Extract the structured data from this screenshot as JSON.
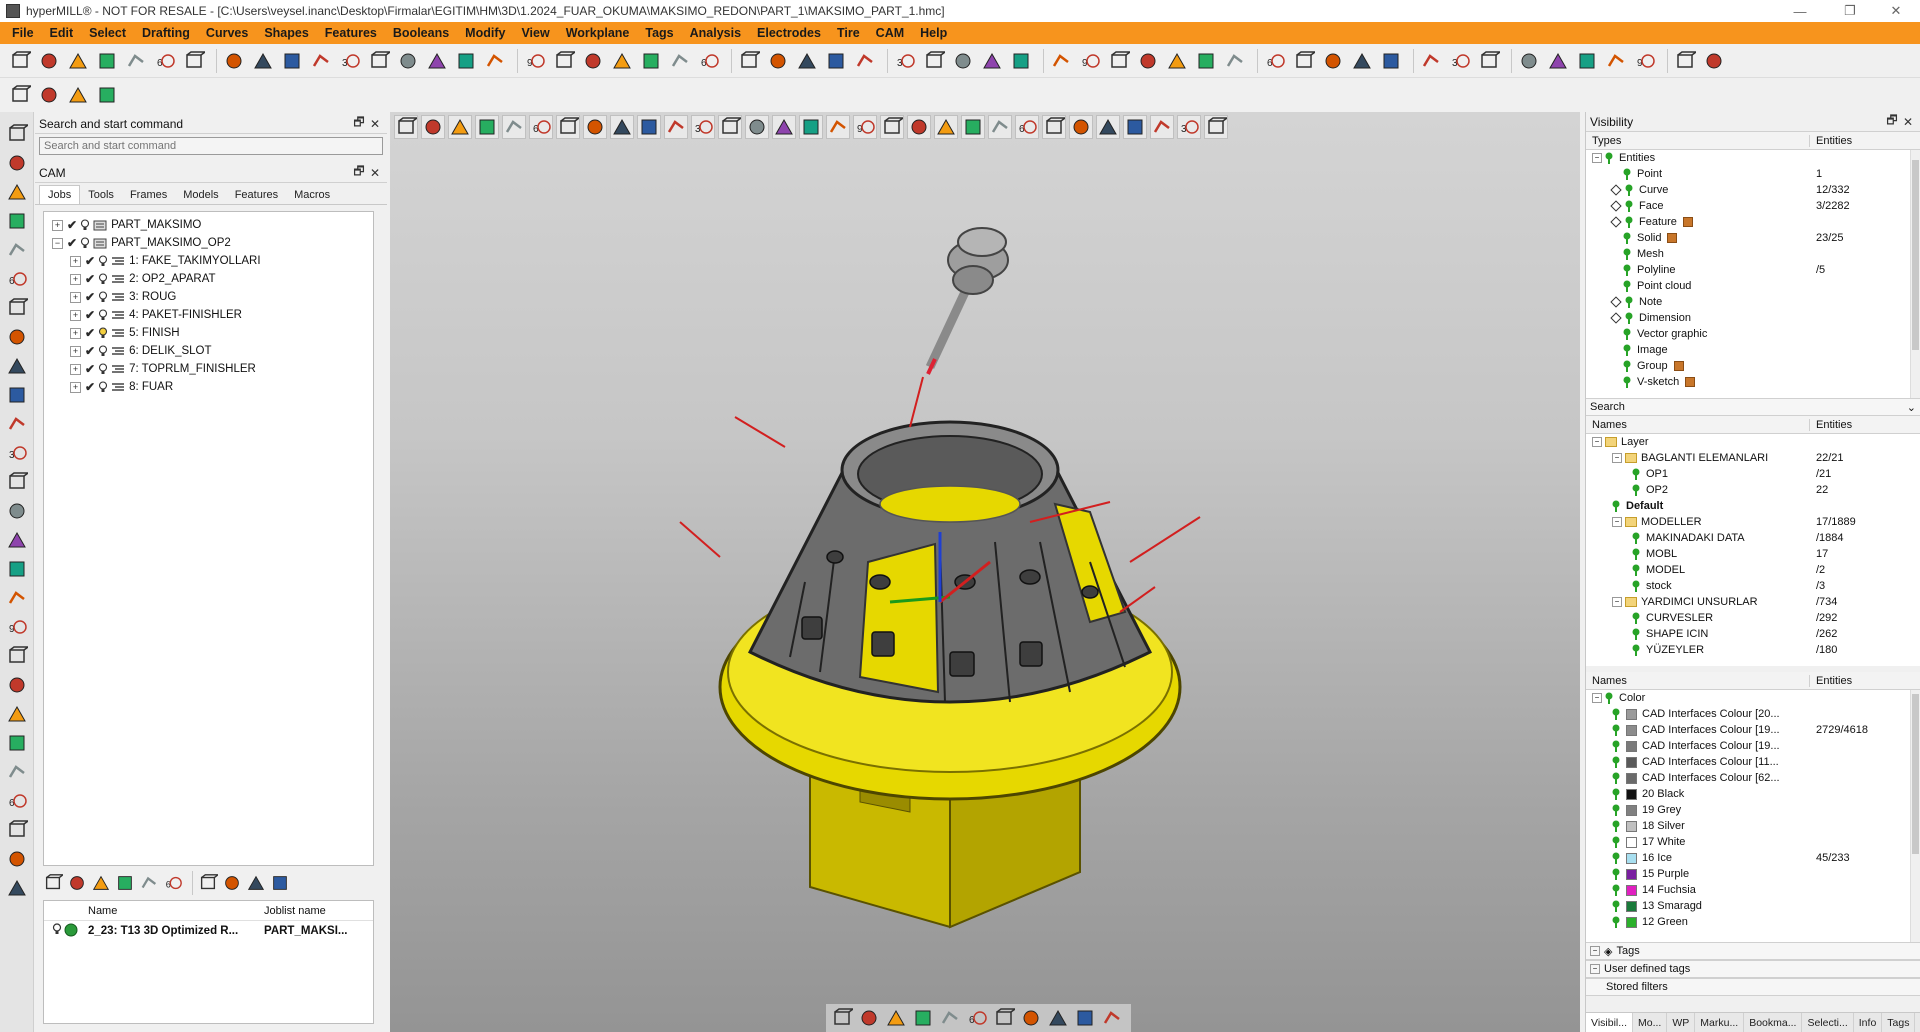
{
  "window": {
    "title": "hyperMILL® - NOT FOR RESALE - [C:\\Users\\veysel.inanc\\Desktop\\Firmalar\\EGITIM\\HM\\3D\\1.2024_FUAR_OKUMA\\MAKSIMO_REDON\\PART_1\\MAKSIMO_PART_1.hmc]",
    "minimize": "—",
    "maximize": "❐",
    "close": "✕"
  },
  "menu": [
    "File",
    "Edit",
    "Select",
    "Drafting",
    "Curves",
    "Shapes",
    "Features",
    "Booleans",
    "Modify",
    "View",
    "Workplane",
    "Tags",
    "Analysis",
    "Electrodes",
    "Tire",
    "CAM",
    "Help"
  ],
  "search_panel": {
    "title": "Search and start command",
    "placeholder": "Search and start command",
    "float_icon": "🗗",
    "close_icon": "✕"
  },
  "cam_panel": {
    "title": "CAM",
    "tabs": [
      "Jobs",
      "Tools",
      "Frames",
      "Models",
      "Features",
      "Macros"
    ],
    "active_tab": "Jobs",
    "tree": [
      {
        "label": "PART_MAKSIMO",
        "level": 0,
        "expander": "+"
      },
      {
        "label": "PART_MAKSIMO_OP2",
        "level": 0,
        "expander": "−"
      },
      {
        "label": "1: FAKE_TAKIMYOLLARI",
        "level": 1,
        "expander": "+"
      },
      {
        "label": "2: OP2_APARAT",
        "level": 1,
        "expander": "+"
      },
      {
        "label": "3: ROUG",
        "level": 1,
        "expander": "+"
      },
      {
        "label": "4: PAKET-FINISHLER",
        "level": 1,
        "expander": "+"
      },
      {
        "label": "5: FINISH",
        "level": 1,
        "expander": "+"
      },
      {
        "label": "6: DELIK_SLOT",
        "level": 1,
        "expander": "+"
      },
      {
        "label": "7: TOPRLM_FINISHLER",
        "level": 1,
        "expander": "+"
      },
      {
        "label": "8: FUAR",
        "level": 1,
        "expander": "+"
      }
    ],
    "check_glyph": "✔",
    "joblist": {
      "col_name": "Name",
      "col_joblist": "Joblist name",
      "row_name": "2_23: T13 3D Optimized R...",
      "row_joblist": "PART_MAKSI..."
    }
  },
  "visibility": {
    "title": "Visibility",
    "types_header": {
      "c1": "Types",
      "c2": "Entities"
    },
    "root": "Entities",
    "types": [
      {
        "label": "Point",
        "value": "1",
        "kind": "pin"
      },
      {
        "label": "Curve",
        "value": "12/332",
        "kind": "diamond"
      },
      {
        "label": "Face",
        "value": "3/2282",
        "kind": "diamond"
      },
      {
        "label": "Feature",
        "value": "",
        "kind": "diamond",
        "cube": true
      },
      {
        "label": "Solid",
        "value": "23/25",
        "kind": "pin",
        "cube": true
      },
      {
        "label": "Mesh",
        "value": "",
        "kind": "pin"
      },
      {
        "label": "Polyline",
        "value": "/5",
        "kind": "pin"
      },
      {
        "label": "Point cloud",
        "value": "",
        "kind": "pin"
      },
      {
        "label": "Note",
        "value": "",
        "kind": "diamond"
      },
      {
        "label": "Dimension",
        "value": "",
        "kind": "diamond"
      },
      {
        "label": "Vector graphic",
        "value": "",
        "kind": "pin"
      },
      {
        "label": "Image",
        "value": "",
        "kind": "pin"
      },
      {
        "label": "Group",
        "value": "",
        "kind": "pin",
        "cube": true
      },
      {
        "label": "V-sketch",
        "value": "",
        "kind": "pin",
        "cube": true
      }
    ],
    "search_label": "Search",
    "names_header": {
      "c1": "Names",
      "c2": "Entities"
    },
    "layer_root": "Layer",
    "layers": [
      {
        "label": "BAGLANTI ELEMANLARI",
        "value": "22/21",
        "level": 1,
        "folder": true
      },
      {
        "label": "OP1",
        "value": "/21",
        "level": 2
      },
      {
        "label": "OP2",
        "value": "22",
        "level": 2
      },
      {
        "label": "Default",
        "value": "",
        "level": 1,
        "bold": true
      },
      {
        "label": "MODELLER",
        "value": "17/1889",
        "level": 1,
        "folder": true
      },
      {
        "label": "MAKINADAKI DATA",
        "value": "/1884",
        "level": 2
      },
      {
        "label": "MOBL",
        "value": "17",
        "level": 2
      },
      {
        "label": "MODEL",
        "value": "/2",
        "level": 2
      },
      {
        "label": "stock",
        "value": "/3",
        "level": 2
      },
      {
        "label": "YARDIMCI UNSURLAR",
        "value": "/734",
        "level": 1,
        "folder": true
      },
      {
        "label": "CURVESLER",
        "value": "/292",
        "level": 2
      },
      {
        "label": "SHAPE ICIN",
        "value": "/262",
        "level": 2
      },
      {
        "label": "YÜZEYLER",
        "value": "/180",
        "level": 2
      }
    ],
    "color_header": {
      "c1": "Names",
      "c2": "Entities"
    },
    "color_root": "Color",
    "colors": [
      {
        "label": "CAD Interfaces Colour [20...",
        "value": "",
        "hex": "#9a9a9a"
      },
      {
        "label": "CAD Interfaces Colour [19...",
        "value": "2729/4618",
        "hex": "#8c8c8c"
      },
      {
        "label": "CAD Interfaces Colour [19...",
        "value": "",
        "hex": "#7a7a7a"
      },
      {
        "label": "CAD Interfaces Colour [11...",
        "value": "",
        "hex": "#5a5a5a"
      },
      {
        "label": "CAD Interfaces Colour [62...",
        "value": "",
        "hex": "#6a6a6a"
      },
      {
        "label": "20 Black",
        "value": "",
        "hex": "#111111"
      },
      {
        "label": "19 Grey",
        "value": "",
        "hex": "#808080"
      },
      {
        "label": "18 Silver",
        "value": "",
        "hex": "#c0c0c0"
      },
      {
        "label": "17 White",
        "value": "",
        "hex": "#ffffff"
      },
      {
        "label": "16 Ice",
        "value": "45/233",
        "hex": "#a8dff0"
      },
      {
        "label": "15 Purple",
        "value": "",
        "hex": "#7a1fa0"
      },
      {
        "label": "14 Fuchsia",
        "value": "",
        "hex": "#e020c0"
      },
      {
        "label": "13 Smaragd",
        "value": "",
        "hex": "#1a7a3a"
      },
      {
        "label": "12 Green",
        "value": "",
        "hex": "#2bb02b"
      }
    ],
    "tags_label": "Tags",
    "user_tags_label": "User defined tags",
    "stored_filters_label": "Stored filters",
    "bottom_tabs": [
      "Visibil...",
      "Mo...",
      "WP",
      "Marku...",
      "Bookma...",
      "Selecti...",
      "Info",
      "Tags"
    ]
  },
  "colors": {
    "menubar": "#f7941d",
    "part_yellow": "#e6d800",
    "part_grey": "#6c6c6c",
    "pin_green": "#27a327"
  }
}
